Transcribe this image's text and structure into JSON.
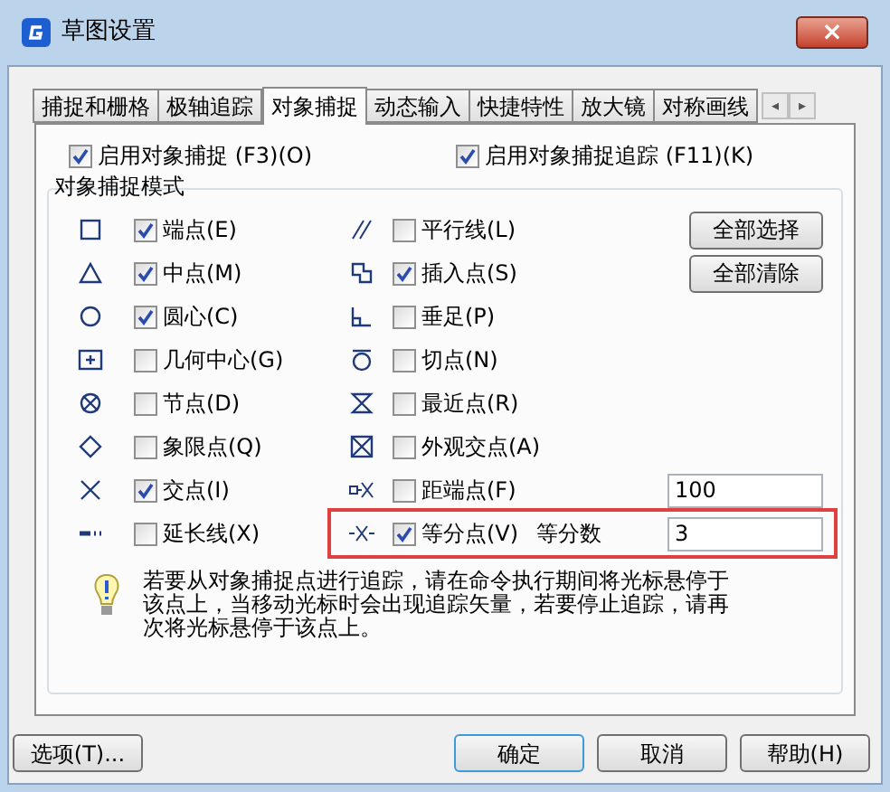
{
  "window": {
    "title": "草图设置",
    "close": "×"
  },
  "tabs": [
    {
      "label": "捕捉和栅格",
      "selected": false
    },
    {
      "label": "极轴追踪",
      "selected": false
    },
    {
      "label": "对象捕捉",
      "selected": true
    },
    {
      "label": "动态输入",
      "selected": false
    },
    {
      "label": "快捷特性",
      "selected": false
    },
    {
      "label": "放大镜",
      "selected": false
    },
    {
      "label": "对称画线",
      "selected": false
    }
  ],
  "tab_scroll": [
    "◂",
    "▸"
  ],
  "top_options": [
    {
      "label": "启用对象捕捉 (F3)(O)",
      "checked": true
    },
    {
      "label": "启用对象捕捉追踪 (F11)(K)",
      "checked": true
    }
  ],
  "group": {
    "title": "对象捕捉模式",
    "left": [
      {
        "label": "端点(E)",
        "checked": true
      },
      {
        "label": "中点(M)",
        "checked": true
      },
      {
        "label": "圆心(C)",
        "checked": true
      },
      {
        "label": "几何中心(G)",
        "checked": false
      },
      {
        "label": "节点(D)",
        "checked": false
      },
      {
        "label": "象限点(Q)",
        "checked": false
      },
      {
        "label": "交点(I)",
        "checked": true
      },
      {
        "label": "延长线(X)",
        "checked": false
      }
    ],
    "right": [
      {
        "label": "平行线(L)",
        "checked": false
      },
      {
        "label": "插入点(S)",
        "checked": true
      },
      {
        "label": "垂足(P)",
        "checked": false
      },
      {
        "label": "切点(N)",
        "checked": false
      },
      {
        "label": "最近点(R)",
        "checked": false
      },
      {
        "label": "外观交点(A)",
        "checked": false
      },
      {
        "label": "距端点(F)",
        "checked": false,
        "value": "100"
      },
      {
        "label": "等分点(V)",
        "checked": true,
        "field_label": "等分数",
        "value": "3",
        "highlighted": true
      }
    ],
    "buttons": [
      "全部选择",
      "全部清除"
    ],
    "hint": "若要从对象捕捉点进行追踪，请在命令执行期间将光标悬停于该点上，当移动光标时会出现追踪矢量，若要停止追踪，请再次将光标悬停于该点上。"
  },
  "footer": {
    "options_button": "选项(T)...",
    "buttons": [
      {
        "label": "确定",
        "default": true
      },
      {
        "label": "取消",
        "default": false
      },
      {
        "label": "帮助(H)",
        "default": false
      }
    ]
  }
}
